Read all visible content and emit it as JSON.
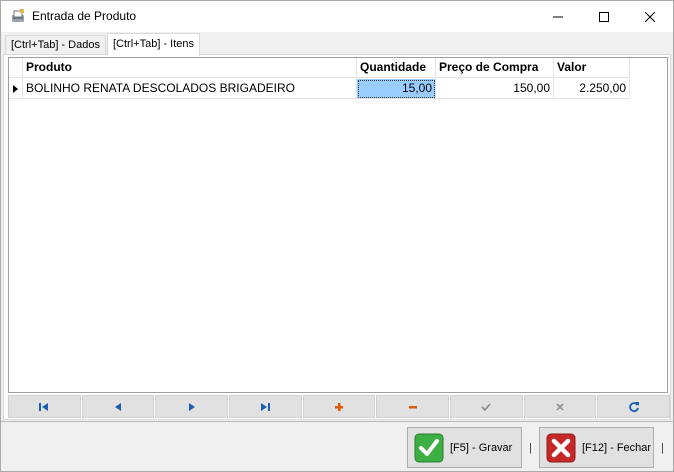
{
  "window": {
    "title": "Entrada de Produto",
    "icon": "product-entry-icon"
  },
  "tabs": [
    {
      "label": "[Ctrl+Tab] - Dados",
      "active": false
    },
    {
      "label": "[Ctrl+Tab] - Itens",
      "active": true
    }
  ],
  "grid": {
    "columns": [
      "Produto",
      "Quantidade",
      "Preço de Compra",
      "Valor"
    ],
    "rows": [
      {
        "produto": "BOLINHO RENATA DESCOLADOS BRIGADEIRO",
        "quantidade": "15,00",
        "preco": "150,00",
        "valor": "2.250,00"
      }
    ],
    "selected_cell": "quantidade"
  },
  "navigator": [
    {
      "name": "first-record-icon",
      "color": "#1a5fb4"
    },
    {
      "name": "prior-record-icon",
      "color": "#1a5fb4"
    },
    {
      "name": "next-record-icon",
      "color": "#1a5fb4"
    },
    {
      "name": "last-record-icon",
      "color": "#1a5fb4"
    },
    {
      "name": "insert-record-icon",
      "color": "#e05a00"
    },
    {
      "name": "delete-record-icon",
      "color": "#e05a00"
    },
    {
      "name": "post-record-icon",
      "color": "#8a8a8a"
    },
    {
      "name": "cancel-record-icon",
      "color": "#8a8a8a"
    },
    {
      "name": "refresh-icon",
      "color": "#1a5fb4"
    }
  ],
  "actions": {
    "save_label": "[F5] - Gravar",
    "close_label": "[F12] - Fechar",
    "separator": "|"
  },
  "colors": {
    "selection": "#99ccff",
    "save_icon": "#3cb043",
    "close_icon": "#c62828"
  }
}
